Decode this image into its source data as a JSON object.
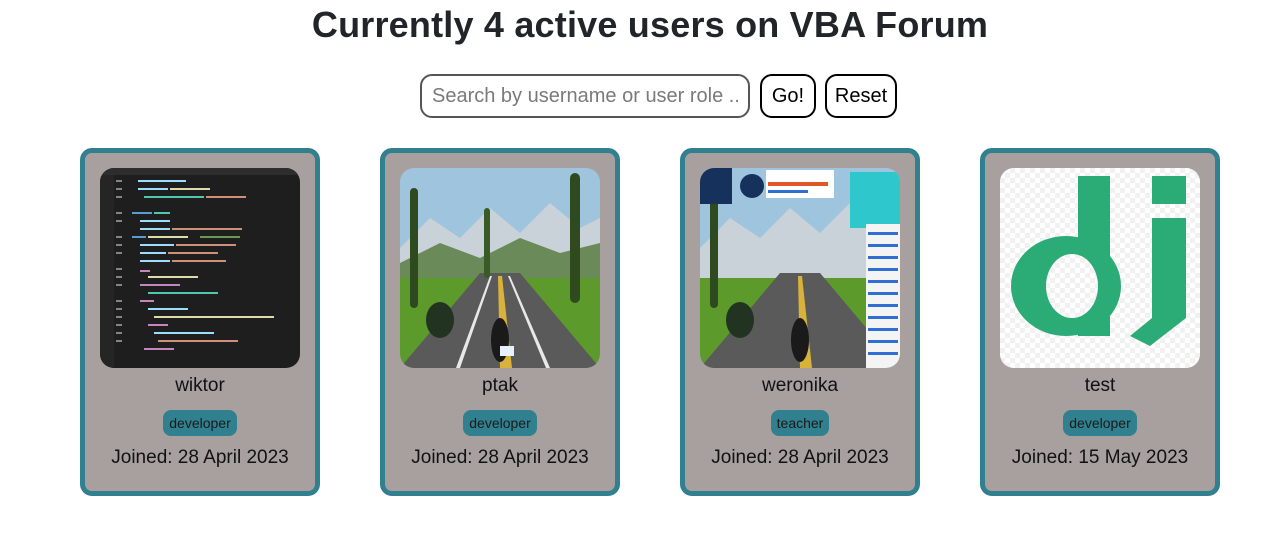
{
  "header": {
    "title": "Currently 4 active users on VBA Forum"
  },
  "search": {
    "placeholder": "Search by username or user role ...",
    "go_label": "Go!",
    "reset_label": "Reset"
  },
  "users": [
    {
      "username": "wiktor",
      "role": "developer",
      "joined": "Joined: 28 April 2023",
      "avatar": "code-editor-screenshot"
    },
    {
      "username": "ptak",
      "role": "developer",
      "joined": "Joined: 28 April 2023",
      "avatar": "cycling-game-screenshot"
    },
    {
      "username": "weronika",
      "role": "teacher",
      "joined": "Joined: 28 April 2023",
      "avatar": "cycling-game-hud-screenshot"
    },
    {
      "username": "test",
      "role": "developer",
      "joined": "Joined: 15 May 2023",
      "avatar": "django-logo"
    }
  ],
  "colors": {
    "card_bg": "#a7a09f",
    "card_border": "#31808f",
    "role_badge": "#31808f",
    "django_green": "#2bac76"
  }
}
